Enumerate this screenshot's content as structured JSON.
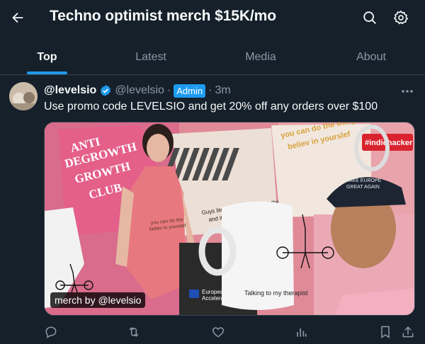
{
  "header": {
    "title": "Techno optimist merch $15K/mo",
    "back_icon": "arrow-left-icon",
    "search_icon": "search-icon",
    "settings_icon": "gear-icon"
  },
  "tabs": [
    {
      "label": "Top",
      "active": true
    },
    {
      "label": "Latest",
      "active": false
    },
    {
      "label": "Media",
      "active": false
    },
    {
      "label": "About",
      "active": false
    }
  ],
  "post": {
    "display_name": "@levelsio",
    "handle": "@levelsio",
    "separator": "·",
    "role_badge": "Admin",
    "time": "3m",
    "text": "Use promo code LEVELSIO and get 20% off any orders over $100",
    "media": {
      "label": "merch by @levelsio",
      "shirt_text": [
        "ANTI",
        "DEGROWTH",
        "GROWTH",
        "CLUB"
      ],
      "poster_text": [
        "you can do the thing",
        "believ in yourslef"
      ],
      "tote_text": [
        "Guys literally only want one thing",
        "and it's fucking disgusting"
      ],
      "mug_text": "Talking to my therapist",
      "sticker_text": "#indiehacker",
      "cap_text": [
        "MAKE EUROPE",
        "GREAT AGAIN"
      ],
      "swimsuit_text": [
        "you can do the",
        "believ in yourslef"
      ],
      "flag_text": [
        "European",
        "Accelerationism"
      ]
    }
  },
  "actions": [
    "reply-icon",
    "repost-icon",
    "like-icon",
    "views-icon",
    "bookmark-icon",
    "share-icon"
  ],
  "colors": {
    "background": "#15202b",
    "accent": "#1d9bf0",
    "muted": "#8b98a5",
    "text": "#f7f9f9",
    "divider": "#38444d"
  }
}
